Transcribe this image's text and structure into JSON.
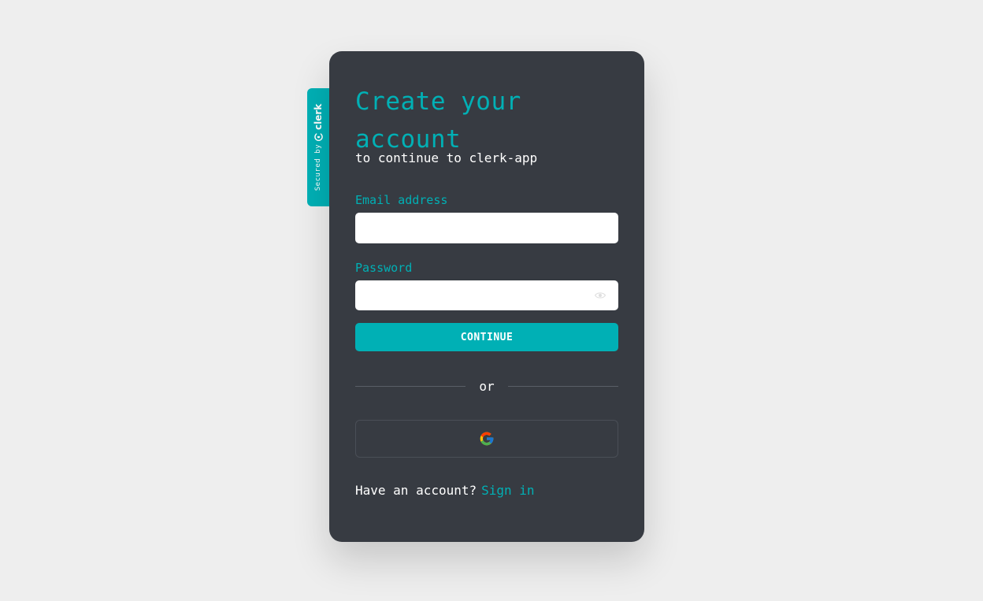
{
  "colors": {
    "accent": "#00b0b5",
    "card_background": "#373b42",
    "page_background": "#eeeeee"
  },
  "badge": {
    "secured_text": "Secured",
    "by_text": "by",
    "brand": "clerk"
  },
  "form": {
    "title": "Create your account",
    "subtitle": "to continue to clerk-app",
    "email_label": "Email address",
    "email_value": "",
    "password_label": "Password",
    "password_value": "",
    "continue_label": "CONTINUE",
    "divider_text": "or",
    "social_provider_icon": "google-icon"
  },
  "footer": {
    "prompt": "Have an account?",
    "link": "Sign in"
  }
}
